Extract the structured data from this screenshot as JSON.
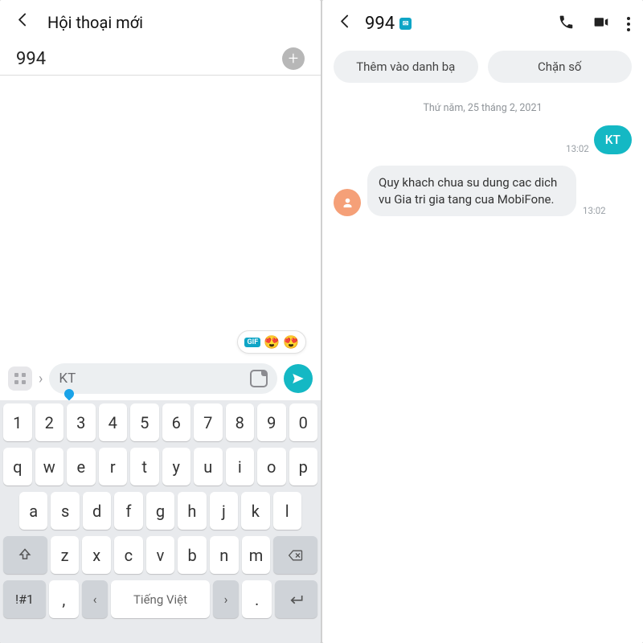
{
  "left": {
    "header_title": "Hội thoại mới",
    "recipient_value": "994",
    "emoji_pill": {
      "badge": "GIF"
    },
    "message_input_value": "KT",
    "keyboard": {
      "row1": [
        "1",
        "2",
        "3",
        "4",
        "5",
        "6",
        "7",
        "8",
        "9",
        "0"
      ],
      "row2": [
        "q",
        "w",
        "e",
        "r",
        "t",
        "y",
        "u",
        "i",
        "o",
        "p"
      ],
      "row3": [
        "a",
        "s",
        "d",
        "f",
        "g",
        "h",
        "j",
        "k",
        "l"
      ],
      "row4_letters": [
        "z",
        "x",
        "c",
        "v",
        "b",
        "n",
        "m"
      ],
      "symbol_label": "!#1",
      "comma": ",",
      "dot": ".",
      "space_label": "Tiếng Việt",
      "lang_prev": "‹",
      "lang_next": "›"
    }
  },
  "right": {
    "contact_number": "994",
    "add_contact_label": "Thêm vào danh bạ",
    "block_label": "Chặn số",
    "date_separator": "Thứ năm, 25 tháng 2, 2021",
    "outgoing": {
      "text": "KT",
      "time": "13:02"
    },
    "incoming": {
      "text": "Quy khach chua su dung cac dich vu Gia tri gia tang cua MobiFone.",
      "time": "13:02"
    }
  },
  "colors": {
    "accent": "#14b8c4",
    "avatar": "#f5a078"
  }
}
